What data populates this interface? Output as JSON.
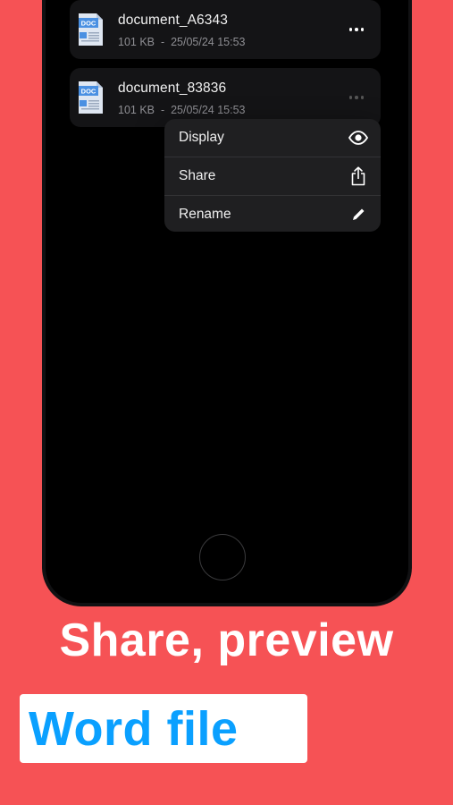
{
  "colors": {
    "background": "#f65255",
    "pill_text": "#0aa0ff",
    "doc_icon": "#4a90e2"
  },
  "files": [
    {
      "name": "document_A6343",
      "size": "101 KB",
      "separator": "-",
      "date": "25/05/24 15:53",
      "icon": "doc-file-icon",
      "more_icon": "ellipsis-icon"
    },
    {
      "name": "document_83836",
      "size": "101 KB",
      "separator": "-",
      "date": "25/05/24 15:53",
      "icon": "doc-file-icon",
      "more_icon": "ellipsis-icon"
    }
  ],
  "doc_icon_label": "DOC",
  "context_menu": {
    "items": [
      {
        "label": "Display",
        "icon": "eye-icon"
      },
      {
        "label": "Share",
        "icon": "share-icon"
      },
      {
        "label": "Rename",
        "icon": "pencil-icon"
      }
    ]
  },
  "promo": {
    "headline": "Share, preview",
    "highlight": "Word file"
  }
}
